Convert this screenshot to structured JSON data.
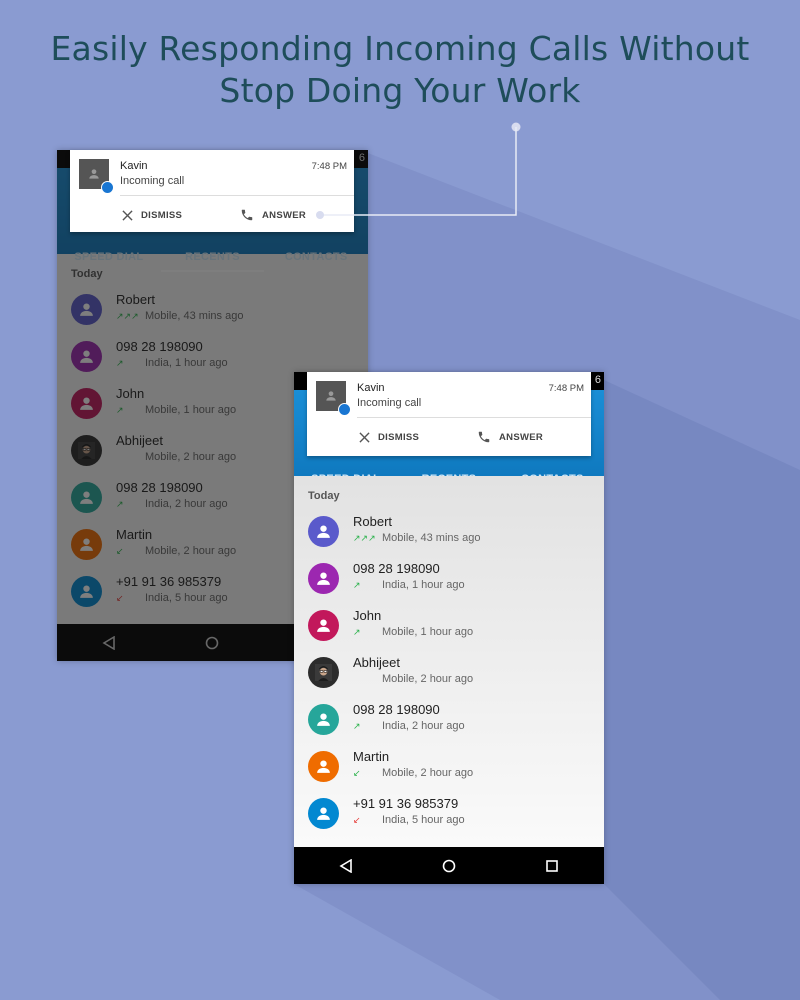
{
  "headline": {
    "line1": "Easily Responding Incoming Calls Without",
    "line2": "Stop Doing Your Work"
  },
  "colors": {
    "background": "#8a9bd1",
    "appbar": "#1a8ed6",
    "headline": "#1e4d5a"
  },
  "status_clock": "6",
  "notification": {
    "caller": "Kavin",
    "message": "Incoming call",
    "time": "7:48 PM",
    "dismiss_label": "DISMISS",
    "answer_label": "ANSWER"
  },
  "tabs": [
    {
      "label": "SPEED DIAL"
    },
    {
      "label": "RECENTS",
      "active": true
    },
    {
      "label": "CONTACTS"
    }
  ],
  "section_label": "Today",
  "calls": [
    {
      "name": "Robert",
      "arrows": "↗↗↗",
      "detail": "Mobile, 43 mins ago",
      "avatar_color": "#5a5acb",
      "type": "outgoing"
    },
    {
      "name": "098 28 198090",
      "arrows": "↗",
      "detail": "India, 1 hour ago",
      "avatar_color": "#9c27b0",
      "type": "outgoing"
    },
    {
      "name": "John",
      "arrows": "↗",
      "detail": "Mobile, 1 hour ago",
      "avatar_color": "#c2185b",
      "type": "outgoing"
    },
    {
      "name": "Abhijeet",
      "arrows": "",
      "detail": "Mobile, 2 hour ago",
      "avatar_color": "#2c2c2c",
      "type": "photo"
    },
    {
      "name": "098 28 198090",
      "arrows": "↗",
      "detail": "India, 2 hour ago",
      "avatar_color": "#26a69a",
      "type": "outgoing"
    },
    {
      "name": "Martin",
      "arrows": "↙",
      "detail": "Mobile, 2 hour ago",
      "avatar_color": "#ef6c00",
      "type": "incoming"
    },
    {
      "name": "+91 91 36 985379",
      "arrows": "↙",
      "detail": "India, 5 hour ago",
      "avatar_color": "#0288d1",
      "type": "missed"
    }
  ],
  "nav_icons": [
    "back-icon",
    "home-icon",
    "recents-square-icon"
  ]
}
